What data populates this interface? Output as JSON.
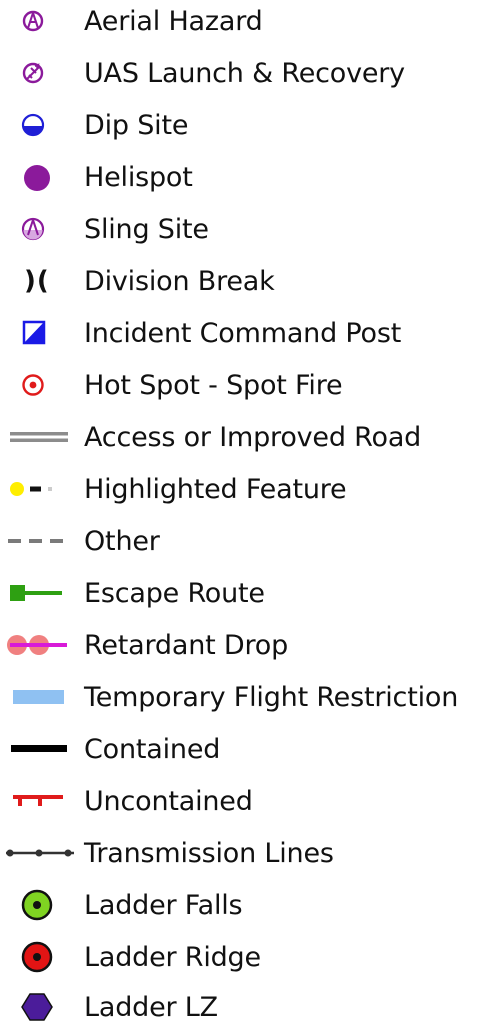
{
  "legend": {
    "items": [
      {
        "label": "Aerial Hazard",
        "icon": "aerial-hazard-icon",
        "color": "#8b1a9b"
      },
      {
        "label": "UAS Launch & Recovery",
        "icon": "uas-launch-recovery-icon",
        "color": "#8b1a9b"
      },
      {
        "label": "Dip Site",
        "icon": "dip-site-icon",
        "color": "#1f1fd6"
      },
      {
        "label": "Helispot",
        "icon": "helispot-icon",
        "color": "#8b1a9b"
      },
      {
        "label": "Sling Site",
        "icon": "sling-site-icon",
        "color": "#8b1a9b"
      },
      {
        "label": ")(",
        "icon": "division-break-icon",
        "color": "#111111"
      },
      {
        "label": "Division Break",
        "icon": "division-break-label",
        "color": "#111111"
      },
      {
        "label": "Incident Command Post",
        "icon": "incident-command-post-icon",
        "color": "#1a1ae6"
      },
      {
        "label": "Hot Spot - Spot Fire",
        "icon": "hot-spot-icon",
        "color": "#e01b1b"
      },
      {
        "label": "Access or Improved Road",
        "icon": "access-road-icon",
        "color": "#8c8c8c"
      },
      {
        "label": "Highlighted Feature",
        "icon": "highlighted-feature-icon",
        "color": "#ffee00"
      },
      {
        "label": "Other",
        "icon": "other-line-icon",
        "color": "#7a7a7a"
      },
      {
        "label": "Escape Route",
        "icon": "escape-route-icon",
        "color": "#2ea012"
      },
      {
        "label": "Retardant Drop",
        "icon": "retardant-drop-icon",
        "color": "#d81ad8"
      },
      {
        "label": "Temporary Flight Restriction",
        "icon": "tfr-icon",
        "color": "#8fc1f2"
      },
      {
        "label": "Contained",
        "icon": "contained-line-icon",
        "color": "#000000"
      },
      {
        "label": "Uncontained",
        "icon": "uncontained-line-icon",
        "color": "#e01b1b"
      },
      {
        "label": "Transmission Lines",
        "icon": "transmission-lines-icon",
        "color": "#333333"
      },
      {
        "label": "Ladder Falls",
        "icon": "ladder-falls-icon",
        "color": "#7fd322"
      },
      {
        "label": "Ladder Ridge",
        "icon": "ladder-ridge-icon",
        "color": "#e21414"
      },
      {
        "label": "Ladder LZ",
        "icon": "ladder-lz-icon",
        "color": "#4b1c9a"
      }
    ]
  }
}
